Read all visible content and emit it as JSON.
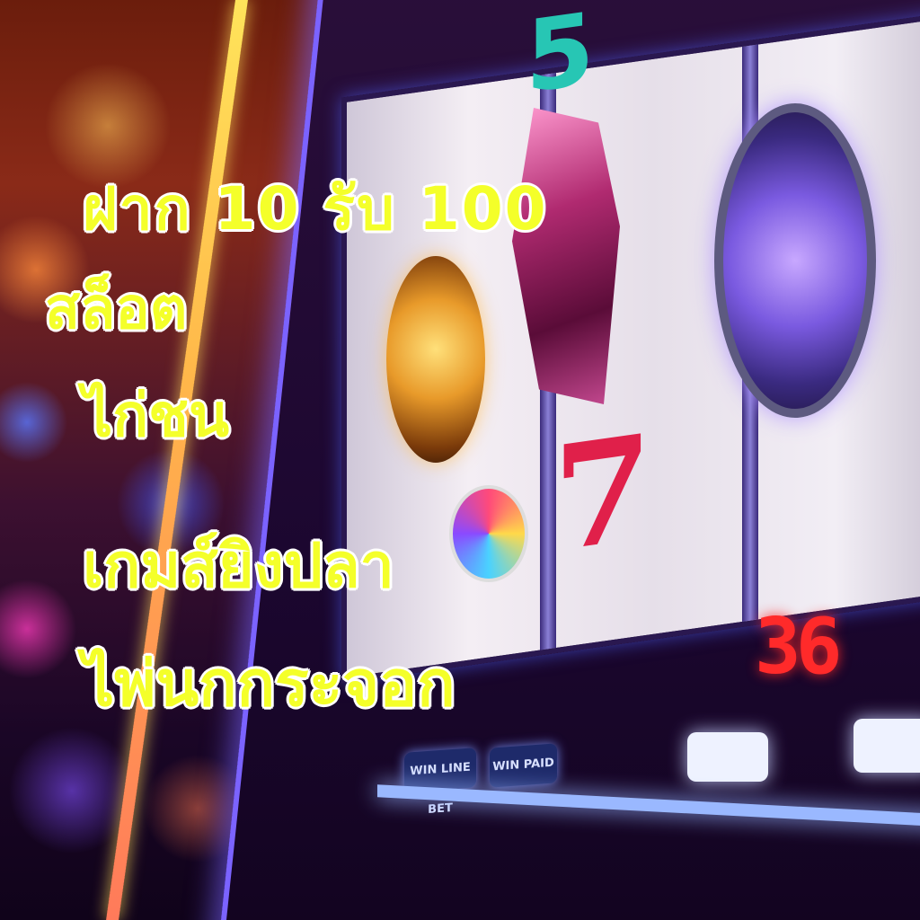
{
  "overlay_text": {
    "line1": "ฝาก 10 รับ 100",
    "line2": "สล็อต",
    "line3": "ไก่ชน",
    "line4": "เกมส์ยิงปลา",
    "line5": "ไพ่นกกระจอก"
  },
  "machine": {
    "seven_symbol": "7",
    "five_symbol": "5",
    "led_display": "36",
    "button_left": "WIN LINE BET",
    "button_right": "WIN PAID"
  },
  "colors": {
    "caption_fill": "#f4ff2a",
    "caption_outline": "#ffffff",
    "neon_blue": "#7b63ff",
    "seven_red": "#e0204a"
  }
}
